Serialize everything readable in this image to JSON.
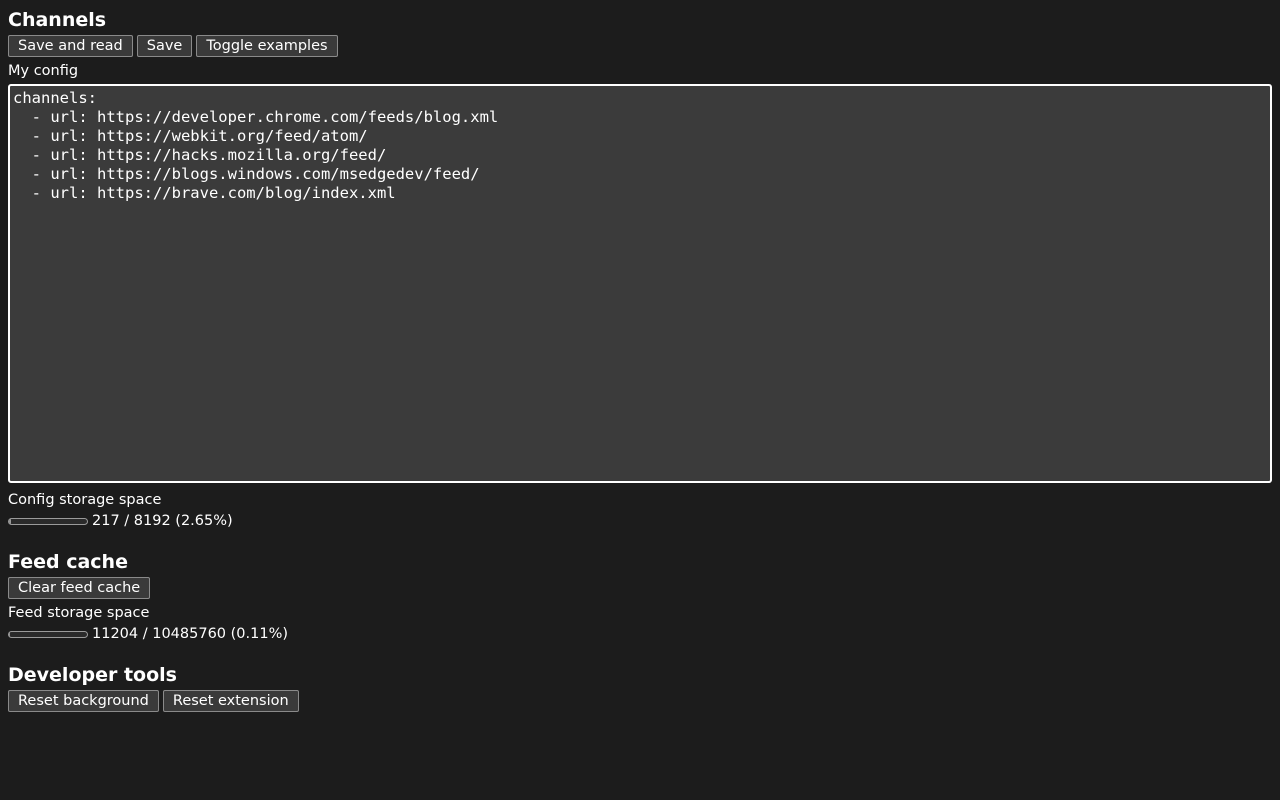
{
  "channels": {
    "heading": "Channels",
    "buttons": {
      "save_and_read": "Save and read",
      "save": "Save",
      "toggle_examples": "Toggle examples"
    },
    "config_label": "My config",
    "config_text": "channels:\n  - url: https://developer.chrome.com/feeds/blog.xml\n  - url: https://webkit.org/feed/atom/\n  - url: https://hacks.mozilla.org/feed/\n  - url: https://blogs.windows.com/msedgedev/feed/\n  - url: https://brave.com/blog/index.xml",
    "storage_label": "Config storage space",
    "storage_used": 217,
    "storage_total": 8192,
    "storage_text": "217 / 8192 (2.65%)",
    "storage_fraction": 0.0265
  },
  "feed_cache": {
    "heading": "Feed cache",
    "clear_button": "Clear feed cache",
    "storage_label": "Feed storage space",
    "storage_used": 11204,
    "storage_total": 10485760,
    "storage_text": "11204 / 10485760 (0.11%)",
    "storage_fraction": 0.0011
  },
  "developer_tools": {
    "heading": "Developer tools",
    "reset_background": "Reset background",
    "reset_extension": "Reset extension"
  },
  "colors": {
    "background": "#1c1c1c",
    "button_bg": "#3a3a3a",
    "textarea_bg": "#3b3b3b",
    "text": "#ffffff"
  }
}
